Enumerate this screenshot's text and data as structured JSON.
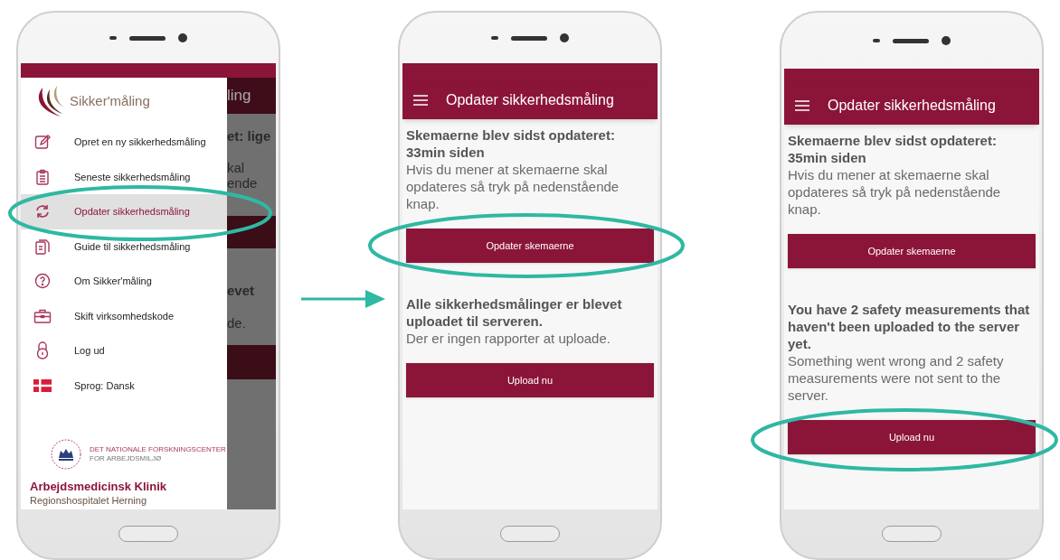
{
  "phones": [
    {
      "kind": "drawer",
      "background_fragments": {
        "title": "ling",
        "text_1": [
          "et: lige"
        ],
        "text_2": [
          "kal",
          "ende"
        ],
        "text_3": [
          "evet"
        ],
        "text_4": [
          "de."
        ]
      },
      "drawer": {
        "app_name": "Sikker'måling",
        "items": [
          {
            "label": "Opret en ny sikkerhedsmåling",
            "selected": false
          },
          {
            "label": "Seneste sikkerhedsmåling",
            "selected": false
          },
          {
            "label": "Opdater sikkerhedsmåling",
            "selected": true
          },
          {
            "label": "Guide til sikkerhedsmåling",
            "selected": false
          },
          {
            "label": "Om Sikker'måling",
            "selected": false
          },
          {
            "label": "Skift virksomhedskode",
            "selected": false
          },
          {
            "label": "Log ud",
            "selected": false
          },
          {
            "label": "Sprog: Dansk",
            "selected": false
          }
        ],
        "footer": {
          "institute_line_1": "DET NATIONALE FORSKNINGSCENTER",
          "institute_line_2": "FOR ARBEJDSMILJØ",
          "clinic": "Arbejdsmedicinsk Klinik",
          "hospital": "Regionshospitalet Herning"
        }
      }
    },
    {
      "kind": "content",
      "app_bar": {
        "title": "Opdater sikkerhedsmåling"
      },
      "sections": [
        {
          "heading": "Skemaerne blev sidst opdateret: 33min siden",
          "body": "Hvis du mener at skemaerne skal opdateres så tryk på nedenstående knap.",
          "button": "Opdater skemaerne"
        },
        {
          "heading": "Alle sikkerhedsmålinger er blevet uploadet til serveren.",
          "body": "Der er ingen rapporter at uploade.",
          "button": "Upload nu"
        }
      ]
    },
    {
      "kind": "content",
      "app_bar": {
        "title": "Opdater sikkerhedsmåling"
      },
      "sections": [
        {
          "heading": "Skemaerne blev sidst opdateret: 35min siden",
          "body": "Hvis du mener at skemaerne skal opdateres så tryk på nedenstående knap.",
          "button": "Opdater skemaerne"
        },
        {
          "heading": "You have 2 safety measurements that haven't been uploaded to the server yet.",
          "body": "Something went wrong and 2 safety measurements were not sent to the server.",
          "button": "Upload nu"
        }
      ]
    }
  ]
}
